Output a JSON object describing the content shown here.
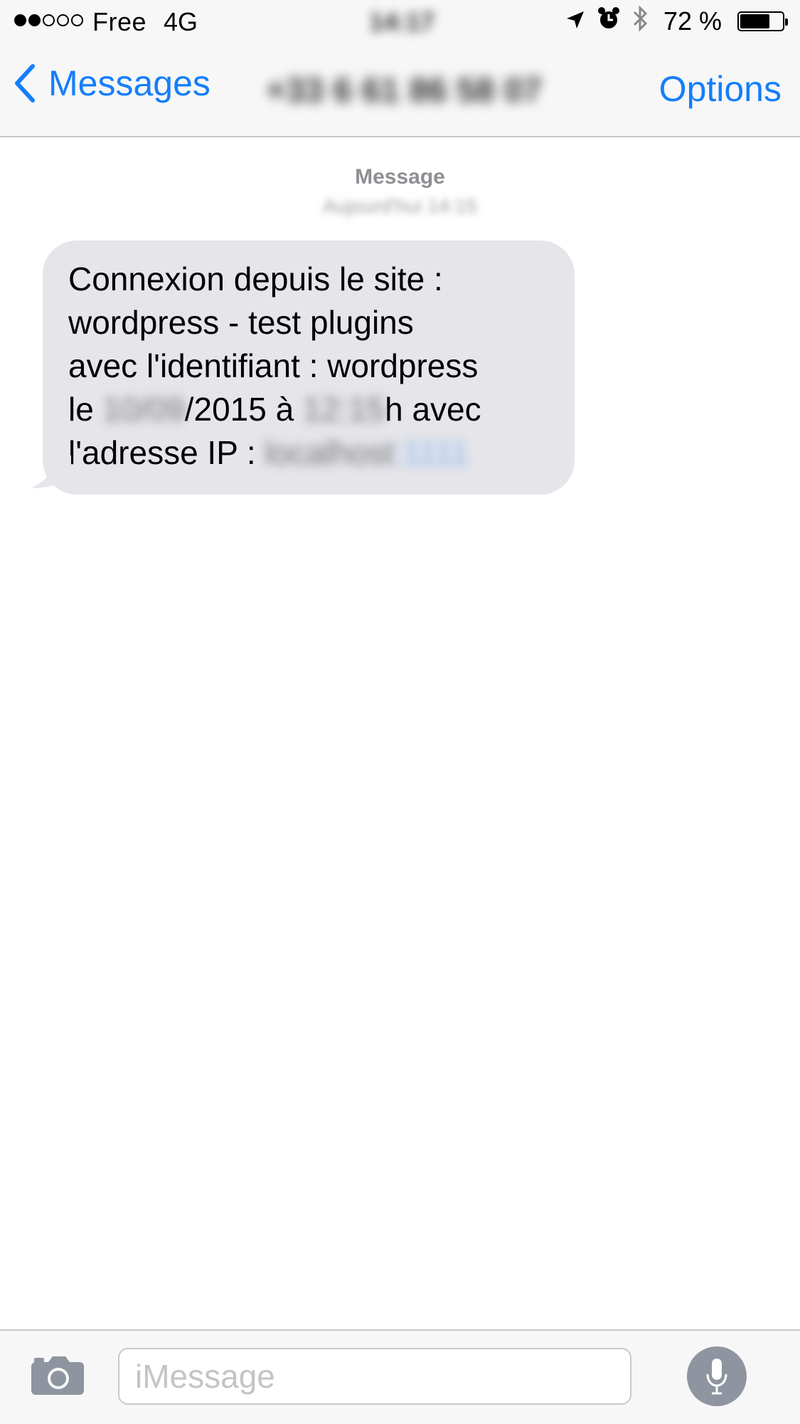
{
  "status_bar": {
    "carrier": "Free",
    "network": "4G",
    "time": "14:17",
    "battery_percent_label": "72 %",
    "battery_level": 0.72
  },
  "nav": {
    "back_label": "Messages",
    "contact": "+33 6 61 86 58 07",
    "options_label": "Options"
  },
  "conversation": {
    "label": "Message",
    "timestamp": "Aujourd'hui 14:15"
  },
  "message": {
    "line1": "Connexion depuis le site :",
    "line2": "wordpress - test plugins",
    "line3": "avec l'identifiant : wordpress",
    "line4_prefix": "le ",
    "date_blur": "10/09",
    "line4_mid": "/2015 à ",
    "time_blur": "12:15",
    "line4_suffix": "h avec",
    "line5_prefix": "l'adresse IP : ",
    "ip_blur": "localhost",
    "ip_link_blur": ":1111"
  },
  "input": {
    "placeholder": "iMessage"
  },
  "colors": {
    "accent": "#157efb",
    "bubble": "#e5e5ea"
  },
  "icons": [
    "location-arrow-icon",
    "alarm-icon",
    "bluetooth-icon",
    "battery-icon",
    "chevron-left-icon",
    "camera-icon",
    "microphone-icon"
  ]
}
